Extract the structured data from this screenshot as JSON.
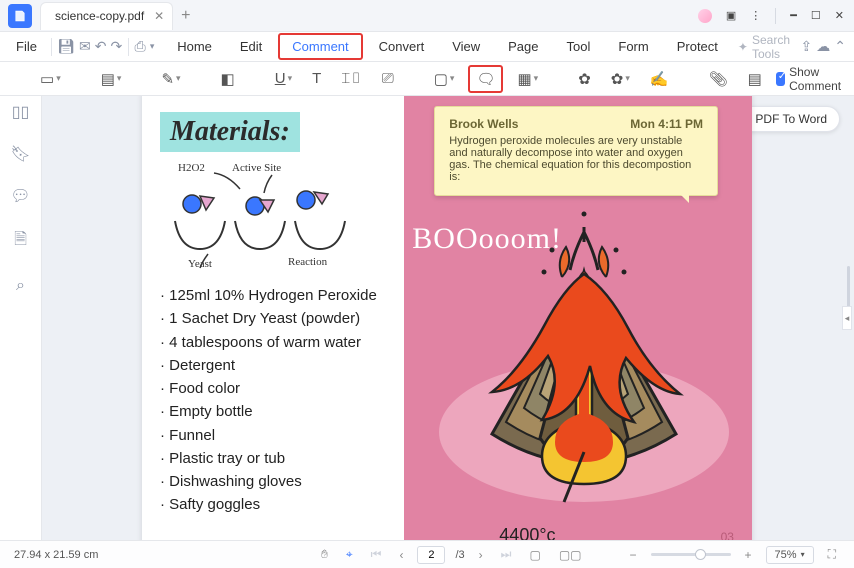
{
  "titlebar": {
    "filename": "science-copy.pdf"
  },
  "menu": {
    "file": "File",
    "items": [
      "Home",
      "Edit",
      "Comment",
      "Convert",
      "View",
      "Page",
      "Tool",
      "Form",
      "Protect"
    ],
    "active_index": 2,
    "search_placeholder": "Search Tools"
  },
  "toolbar": {
    "show_comment_label": "Show Comment"
  },
  "pdf_to_word_label": "PDF To Word",
  "sticky": {
    "author": "Brook Wells",
    "timestamp": "Mon 4:11 PM",
    "body": "Hydrogen peroxide molecules are very unstable and naturally decompose into water and oxygen gas. The chemical equation for this decompostion is:"
  },
  "doc": {
    "title": "Materials:",
    "diagram_labels": {
      "h2o2": "H2O2",
      "active_site": "Active Site",
      "yeast": "Yeast",
      "reaction": "Reaction"
    },
    "list": [
      "125ml 10% Hydrogen Peroxide",
      "1 Sachet Dry Yeast (powder)",
      "4 tablespoons of warm water",
      "Detergent",
      "Food color",
      "Empty bottle",
      "Funnel",
      "Plastic tray or tub",
      "Dishwashing gloves",
      "Safty goggles"
    ],
    "boom": "BOOooom!",
    "temp": "4400°c",
    "right_page_num": "03"
  },
  "status": {
    "dims": "27.94 x 21.59 cm",
    "page_current": "2",
    "page_total": "/3",
    "zoom": "75%"
  }
}
